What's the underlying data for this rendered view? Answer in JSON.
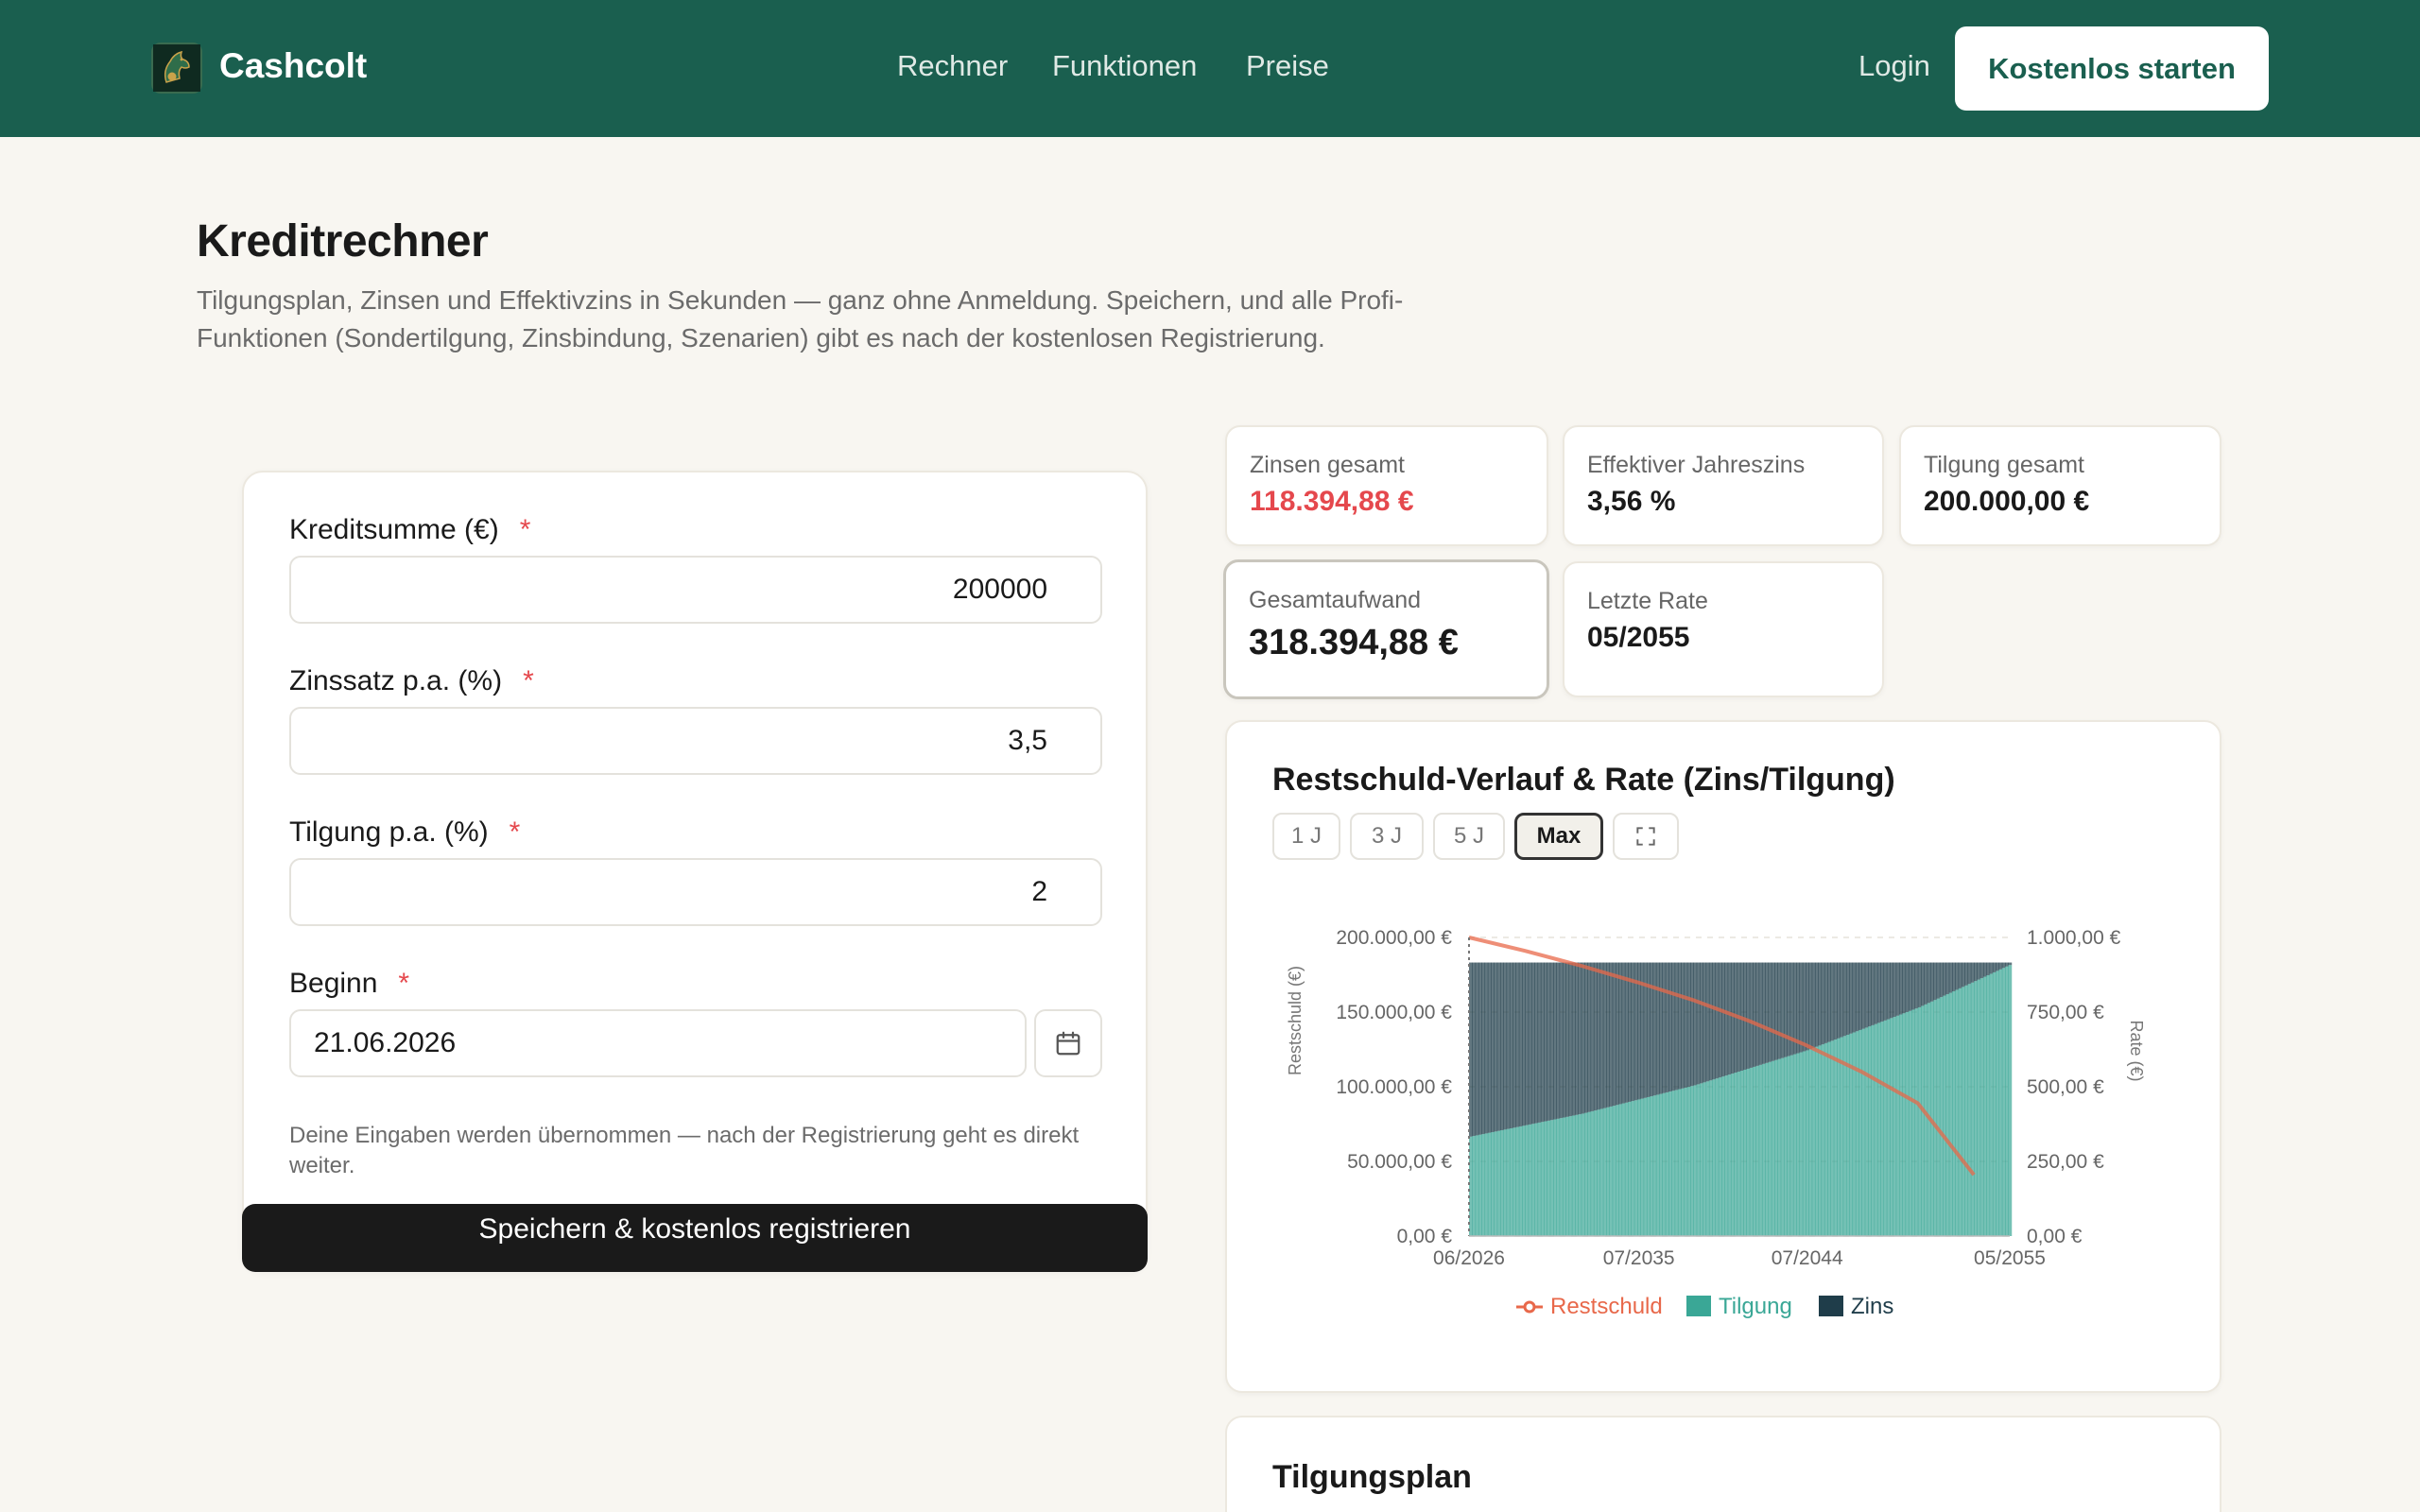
{
  "header": {
    "brand": "Cashcolt",
    "nav": [
      "Rechner",
      "Funktionen",
      "Preise"
    ],
    "login": "Login",
    "cta": "Kostenlos starten"
  },
  "page": {
    "title": "Kreditrechner",
    "description": "Tilgungsplan, Zinsen und Effektivzins in Sekunden — ganz ohne Anmeldung. Speichern, und alle Profi-Funktionen (Sondertilgung, Zinsbindung, Szenarien) gibt es nach der kostenlosen Registrierung."
  },
  "form": {
    "fields": [
      {
        "label": "Kreditsumme (€)",
        "required": "*",
        "value": "200000"
      },
      {
        "label": "Zinssatz p.a. (%)",
        "required": "*",
        "value": "3,5"
      },
      {
        "label": "Tilgung p.a. (%)",
        "required": "*",
        "value": "2"
      },
      {
        "label": "Beginn",
        "required": "*",
        "value": "21.06.2026"
      }
    ],
    "hint": "Deine Eingaben werden übernommen — nach der Registrierung geht es direkt weiter.",
    "submit": "Speichern & kostenlos registrieren"
  },
  "stats": [
    {
      "label": "Zinsen gesamt",
      "value": "118.394,88 €",
      "color": "#e5484d"
    },
    {
      "label": "Effektiver Jahreszins",
      "value": "3,56 %"
    },
    {
      "label": "Tilgung gesamt",
      "value": "200.000,00 €"
    },
    {
      "label": "Gesamtaufwand",
      "value": "318.394,88 €"
    },
    {
      "label": "Letzte Rate",
      "value": "05/2055"
    }
  ],
  "chart_card": {
    "title": "Restschuld-Verlauf & Rate (Zins/Tilgung)",
    "ranges": [
      "1 J",
      "3 J",
      "5 J",
      "Max"
    ],
    "active_range": "Max",
    "expand_icon": "fullscreen-icon"
  },
  "chart_data": {
    "type": "bar",
    "x_ticks": [
      "06/2026",
      "07/2035",
      "07/2044",
      "05/2055"
    ],
    "x_range": [
      "06/2026",
      "05/2055"
    ],
    "y_left": {
      "label": "Restschuld (€)",
      "ticks": [
        "200.000,00 €",
        "150.000,00 €",
        "100.000,00 €",
        "50.000,00 €",
        "0,00 €"
      ],
      "ylim": [
        0,
        200000
      ]
    },
    "y_right": {
      "label": "Rate (€)",
      "ticks": [
        "1.000,00 €",
        "750,00 €",
        "500,00 €",
        "250,00 €",
        "0,00 €"
      ],
      "ylim": [
        0,
        1000
      ]
    },
    "series": [
      {
        "name": "Restschuld",
        "type": "line",
        "axis": "left",
        "color": "#e8684a",
        "x": [
          "06/2026",
          "06/2029",
          "06/2032",
          "06/2035",
          "06/2038",
          "06/2041",
          "06/2044",
          "06/2047",
          "06/2050",
          "06/2053"
        ],
        "values": [
          200000,
          191000,
          181000,
          170000,
          158000,
          144000,
          128000,
          110000,
          89000,
          41000
        ]
      },
      {
        "name": "Tilgung",
        "type": "stacked-bar",
        "axis": "right",
        "color": "#3aa796",
        "x": [
          "06/2026",
          "06/2032",
          "06/2038",
          "06/2044",
          "06/2050",
          "05/2055"
        ],
        "values": [
          333,
          410,
          505,
          622,
          766,
          910
        ]
      },
      {
        "name": "Zins",
        "type": "stacked-bar",
        "axis": "right",
        "color": "#1f3d4a",
        "x": [
          "06/2026",
          "06/2032",
          "06/2038",
          "06/2044",
          "06/2050",
          "05/2055"
        ],
        "values": [
          583,
          506,
          411,
          294,
          150,
          6
        ]
      }
    ],
    "legend": [
      "Restschuld",
      "Tilgung",
      "Zins"
    ],
    "legend_position": "bottom",
    "grid": true
  },
  "plan": {
    "title": "Tilgungsplan"
  }
}
